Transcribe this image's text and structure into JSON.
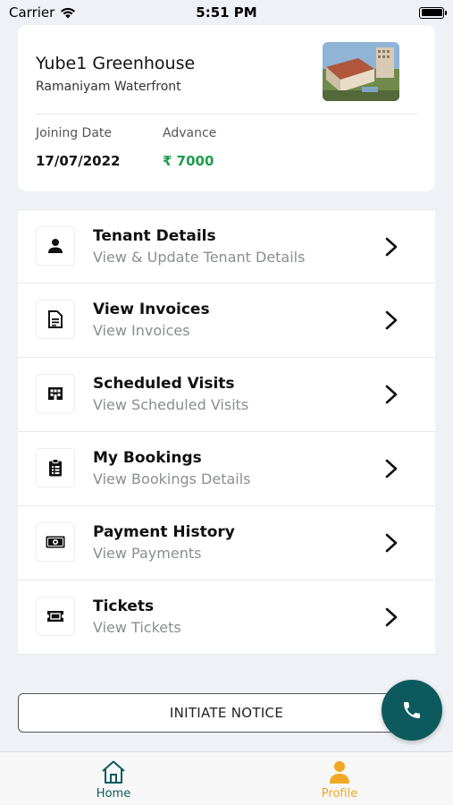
{
  "status_bar": {
    "carrier": "Carrier",
    "time": "5:51 PM"
  },
  "property": {
    "name": "Yube1 Greenhouse",
    "location": "Ramaniyam Waterfront",
    "joining_date_label": "Joining Date",
    "joining_date": "17/07/2022",
    "advance_label": "Advance",
    "advance": "₹ 7000"
  },
  "menu": [
    {
      "title": "Tenant Details",
      "subtitle": "View & Update Tenant Details",
      "icon": "person-icon"
    },
    {
      "title": "View Invoices",
      "subtitle": "View Invoices",
      "icon": "document-icon"
    },
    {
      "title": "Scheduled Visits",
      "subtitle": "View Scheduled Visits",
      "icon": "building-icon"
    },
    {
      "title": "My Bookings",
      "subtitle": "View Bookings Details",
      "icon": "clipboard-icon"
    },
    {
      "title": "Payment History",
      "subtitle": "View Payments",
      "icon": "cash-icon"
    },
    {
      "title": "Tickets",
      "subtitle": "View Tickets",
      "icon": "ticket-icon"
    }
  ],
  "notice_button": "INITIATE NOTICE",
  "tabs": [
    {
      "label": "Home",
      "icon": "home-icon"
    },
    {
      "label": "Profile",
      "icon": "profile-icon"
    }
  ],
  "colors": {
    "accent": "#0d5a5e",
    "active_tab": "#f0a823",
    "advance": "#1e9e4a"
  }
}
